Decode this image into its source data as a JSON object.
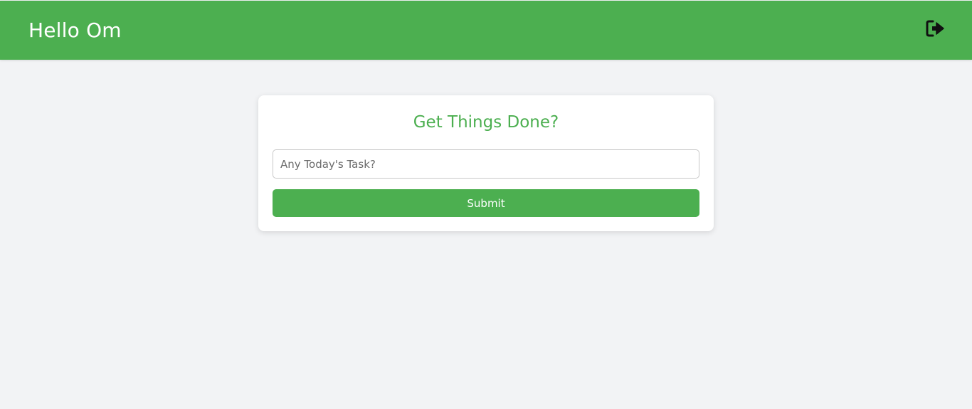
{
  "header": {
    "greeting": "Hello Om",
    "logout_icon": "sign-out-icon",
    "bar_color": "#4caf50"
  },
  "task_card": {
    "title": "Get Things Done?",
    "input": {
      "placeholder": "Any Today's Task?",
      "value": ""
    },
    "submit_label": "Submit",
    "accent_color": "#4caf50"
  },
  "page": {
    "background_color": "#f2f3f5"
  }
}
